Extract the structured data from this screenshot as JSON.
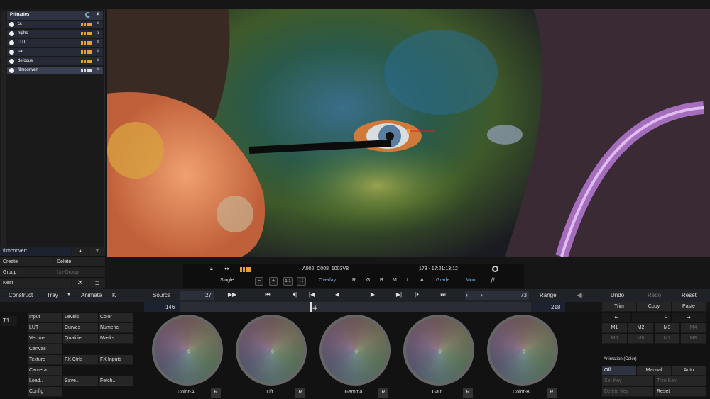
{
  "layers": {
    "header": "Primaries",
    "header_a": "A",
    "items": [
      {
        "label": "cc",
        "a": "A"
      },
      {
        "label": "highs",
        "a": "a"
      },
      {
        "label": "LUT",
        "a": "A"
      },
      {
        "label": "sat",
        "a": "A"
      },
      {
        "label": "defocus",
        "a": "A"
      },
      {
        "label": "filmconvert",
        "a": "A"
      }
    ],
    "current": "filmconvert",
    "create": "Create",
    "delete": "Delete",
    "group": "Group",
    "ungroup": "Un-Group",
    "nest": "Nest"
  },
  "infobar": {
    "clip_name": "A002_C008_1003V8",
    "timecode": "173  -  17:21:13:12",
    "single": "Single",
    "overlay": "Overlay",
    "channels": [
      "R",
      "G",
      "B",
      "M",
      "L",
      "A"
    ],
    "grade": "Grade",
    "mon": "Mon",
    "fit_1to1": "1:1"
  },
  "transport": {
    "construct": "Construct",
    "tray": "Tray",
    "animate": "Animate",
    "k": "K",
    "source": "Source",
    "source_frame": "27",
    "end_frame": "73",
    "range": "Range",
    "undo": "Undo",
    "redo": "Redo",
    "reset": "Reset",
    "range_start": "146",
    "range_end": "218"
  },
  "menu": {
    "tab": "T1",
    "col1": [
      "Input",
      "LUT",
      "Vectors",
      "Canvas",
      "Texture",
      "Camera",
      "Load..",
      "Config"
    ],
    "col2": [
      "Levels",
      "Curves",
      "Qualifier",
      "FX Ctrls",
      "Save.."
    ],
    "col3": [
      "Color",
      "Numeric",
      "Masks",
      "FX Inputs",
      "Fetch.."
    ]
  },
  "wheels": [
    {
      "label": "Color-A",
      "reset": "R"
    },
    {
      "label": "Lift",
      "reset": "R"
    },
    {
      "label": "Gamma",
      "reset": "R"
    },
    {
      "label": "Gain",
      "reset": "R"
    },
    {
      "label": "Color-B",
      "reset": "R"
    }
  ],
  "right": {
    "trim": "Trim",
    "copy": "Copy",
    "paste": "Paste",
    "counter": "0",
    "memories": [
      "M1",
      "M2",
      "M3",
      "M4",
      "M5",
      "M6",
      "M7",
      "M8"
    ],
    "animation_title": "Animation (Color)",
    "off": "Off",
    "manual": "Manual",
    "auto": "Auto",
    "set_key": "Set Key",
    "trim_key": "Trim Key",
    "delete_key": "Delete Key",
    "reset": "Reset"
  },
  "colors": {
    "accent": "#c85a2a",
    "selected_blue": "#4a90e0",
    "bars": "#e8a030"
  }
}
